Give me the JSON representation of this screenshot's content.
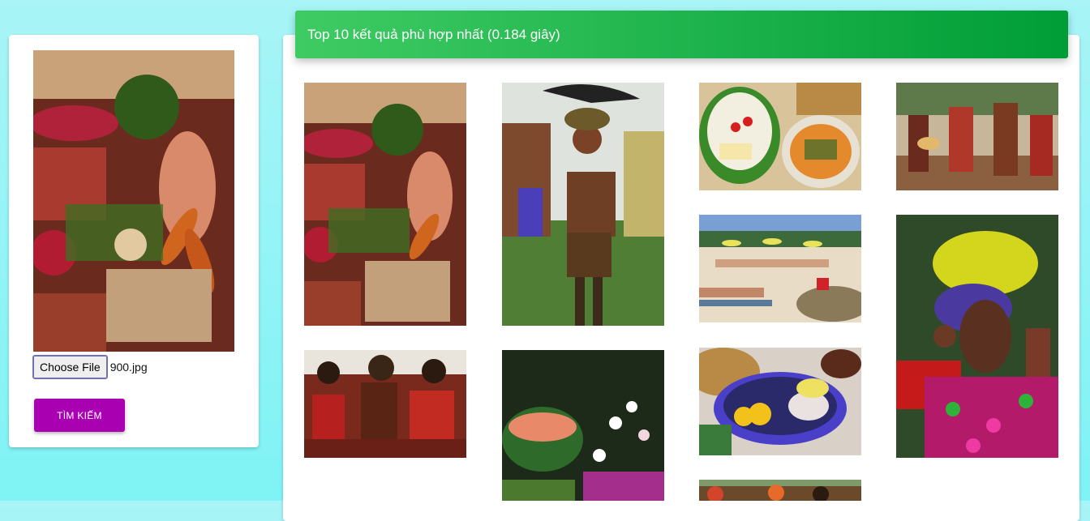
{
  "query": {
    "file_button_label": "Choose File",
    "file_name": "900.jpg",
    "search_label": "TÌM KIẾM"
  },
  "results": {
    "banner_text": "Top 10 kết quả phù hợp nhất (0.184 giây)"
  }
}
